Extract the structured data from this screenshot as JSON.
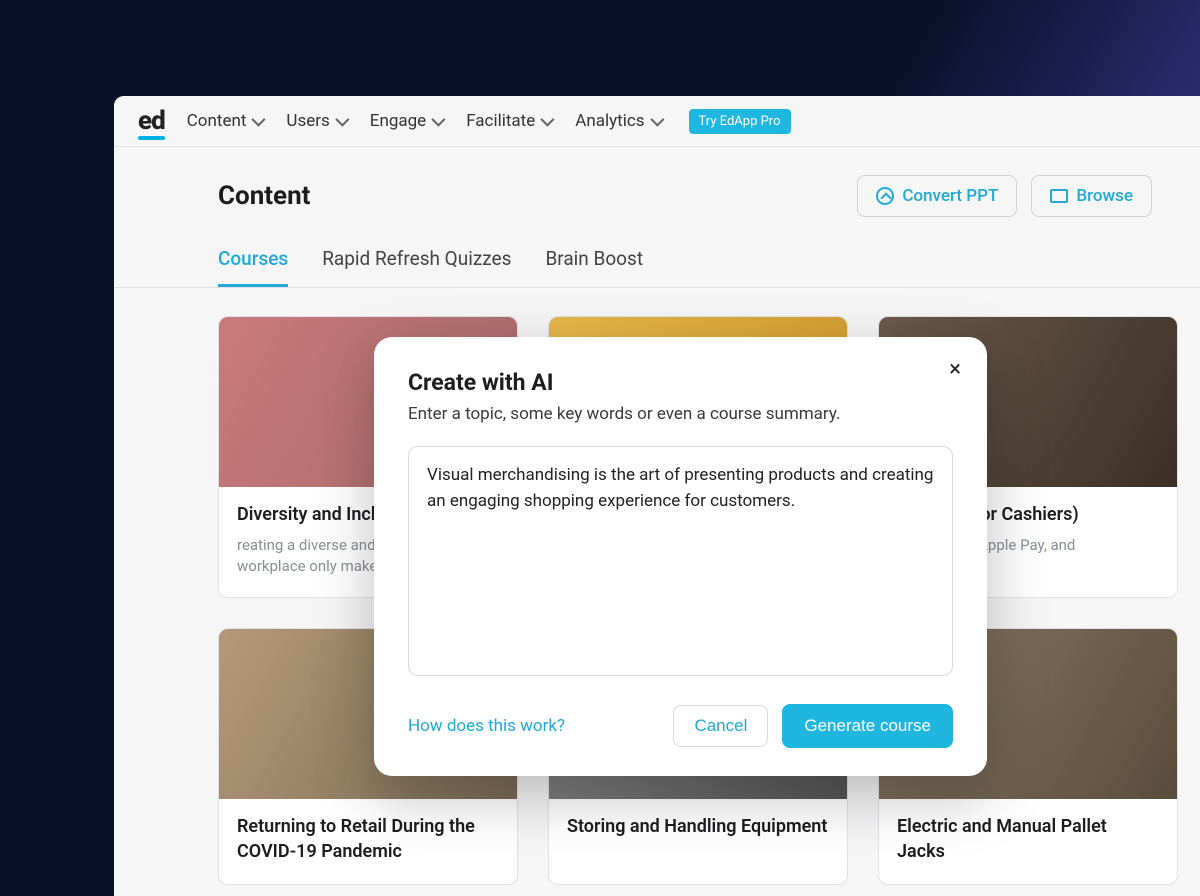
{
  "logo": "ed",
  "nav": {
    "items": [
      "Content",
      "Users",
      "Engage",
      "Facilitate",
      "Analytics"
    ],
    "try_pro": "Try EdApp Pro"
  },
  "header": {
    "title": "Content",
    "convert_ppt": "Convert PPT",
    "browse": "Browse"
  },
  "tabs": {
    "items": [
      "Courses",
      "Rapid Refresh Quizzes",
      "Brain Boost"
    ],
    "active_index": 0
  },
  "cards": [
    {
      "title": "Diversity and Inclusion in Retail",
      "sub": "reating a diverse and inclusive workplace only makes us str…"
    },
    {
      "title": "",
      "sub": ""
    },
    {
      "title": "Security (for Cashiers)",
      "sub": "use Square, Apple Pay, and contactless…"
    },
    {
      "title": "Returning to Retail During the COVID-19 Pandemic",
      "sub": ""
    },
    {
      "title": "Storing and Handling Equipment",
      "sub": ""
    },
    {
      "title": "Electric and Manual Pallet Jacks",
      "sub": ""
    }
  ],
  "modal": {
    "title": "Create with AI",
    "subtitle": "Enter a topic, some key words or even a course summary.",
    "textarea_value": "Visual merchandising is the art of presenting products and creating an engaging shopping experience for customers.",
    "help_link": "How does this work?",
    "cancel": "Cancel",
    "generate": "Generate course"
  }
}
